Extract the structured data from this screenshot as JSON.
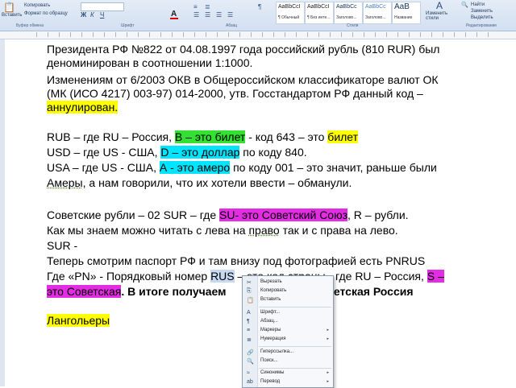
{
  "ribbon": {
    "paste_label": "Вставить",
    "copy_label": "Копировать",
    "format_painter_label": "Формат по образцу",
    "clipboard_group": "Буфер обмена",
    "font_group": "Шрифт",
    "paragraph_group": "Абзац",
    "styles_group": "Стили",
    "editing_group": "Редактирование",
    "font_color_glyph": "A",
    "styles": [
      {
        "sample": "AaBbCcI",
        "name": "¶ Обычный"
      },
      {
        "sample": "AaBbCcI",
        "name": "¶ Без инте..."
      },
      {
        "sample": "AaBbCc",
        "name": "Заголово..."
      },
      {
        "sample": "AaBbCc",
        "name": "Заголово..."
      },
      {
        "sample": "AaB",
        "name": "Название"
      }
    ],
    "change_styles_label": "Изменить стили",
    "find_label": "Найти",
    "replace_label": "Заменить",
    "select_label": "Выделить"
  },
  "document": {
    "p1_l1": "Президента РФ №822 от 04.08.1997 года российский рубль (810 RUR) был",
    "p1_l2": "деноминирован в соотношении 1:1000.",
    "p2_l1": " Изменениям от 6/2003 ОКВ в Общероссийском классификаторе валют ОК",
    "p2_l2": "(МК (ИСО 4217) 003-97) 014-2000, утв. Госстандартом РФ данный код –",
    "p2_l3": "аннулирован.",
    "rub_a": "RUB – где RU – Россия, ",
    "rub_b": "B – это билет",
    "rub_c": " - код 643 – это ",
    "rub_d": "билет",
    "usd_a": "USD – где US  - США, ",
    "usd_b": "D – это доллар",
    "usd_c": " по коду 840.",
    "usa_a": "USA – где US  - США, ",
    "usa_b": "А  - это амеро",
    "usa_c": " по коду 001 – это значит, раньше были",
    "usa_l2a": "Амеры",
    "usa_l2b": ", а нам говорили, что их хотели ввести – обманули.",
    "sov_a": "Советские рубли – 02 SUR – где ",
    "sov_b": "SU- это Советский Союз",
    "sov_c": ", R – рубли.",
    "sov_l2a": "Как мы знаем можно читать с лева на ",
    "sov_l2b": "право",
    "sov_l2c": " так и с права на лево.",
    "sov_l3": " SUR -",
    "pass_l1": "Теперь смотрим паспорт РФ и там внизу под фотографией есть PNRUS",
    "pass_l2a": "Где «PN» - Порядковый номер ",
    "pass_l2b": "RUS",
    "pass_l2c": " – это код страны - где RU – Россия, ",
    "pass_l2d": "S –",
    "pass_l3a": "это Советская",
    "pass_l3b": ". В итоге получаем",
    "pass_l3c": "ветская Россия",
    "last": "Лангольеры"
  },
  "context_menu": {
    "items": [
      {
        "icon": "✂",
        "label": "Вырезать",
        "arrow": ""
      },
      {
        "icon": "⎘",
        "label": "Копировать",
        "arrow": ""
      },
      {
        "icon": "📋",
        "label": "Вставить",
        "arrow": ""
      },
      {
        "icon": "A",
        "label": "Шрифт...",
        "arrow": ""
      },
      {
        "icon": "¶",
        "label": "Абзац...",
        "arrow": ""
      },
      {
        "icon": "≡",
        "label": "Маркеры",
        "arrow": "▸"
      },
      {
        "icon": "≣",
        "label": "Нумерация",
        "arrow": "▸"
      },
      {
        "icon": "🔗",
        "label": "Гиперссылка...",
        "arrow": ""
      },
      {
        "icon": "🔍",
        "label": "Поиск...",
        "arrow": ""
      },
      {
        "icon": "≈",
        "label": "Синонимы",
        "arrow": "▸"
      },
      {
        "icon": "ab",
        "label": "Перевод",
        "arrow": "▸"
      }
    ]
  },
  "colors": {
    "highlight_yellow": "#ffff00",
    "highlight_green": "#33e033",
    "highlight_cyan": "#00e5ff",
    "highlight_magenta": "#e22de2",
    "ribbon_bg": "#d3e0f1"
  }
}
